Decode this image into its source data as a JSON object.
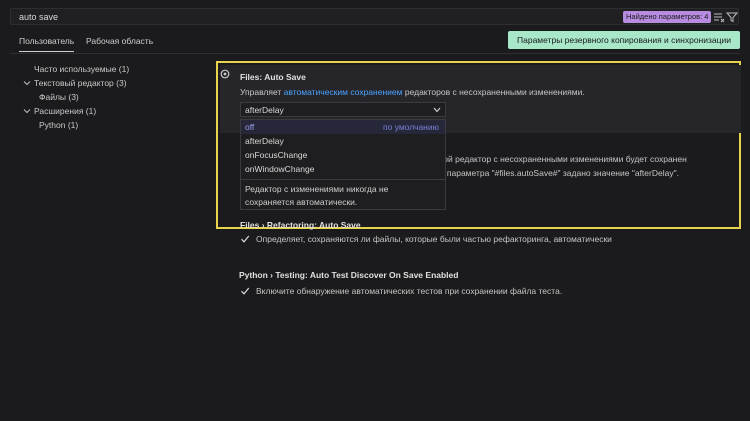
{
  "search": {
    "value": "auto save",
    "found_badge": "Найдено параметров: 4"
  },
  "toolbar": {
    "icons": [
      "clear-filter-icon",
      "filter-icon"
    ]
  },
  "tabs": [
    {
      "label": "Пользователь"
    },
    {
      "label": "Рабочая область"
    }
  ],
  "sync_button": {
    "label": "Параметры резервного копирования и синхронизации"
  },
  "toc": [
    {
      "label": "Часто используемые (1)"
    },
    {
      "label": "Текстовый редактор (3)"
    },
    {
      "label": "Файлы (3)"
    },
    {
      "label": "Расширения (1)"
    },
    {
      "label": "Python (1)"
    }
  ],
  "settings": {
    "auto_save": {
      "title": "Files: Auto Save",
      "desc_before": "Управляет ",
      "desc_link": "автоматическим сохранением",
      "desc_after": " редакторов с несохраненными изменениями.",
      "value": "afterDelay",
      "options": [
        "off",
        "afterDelay",
        "onFocusChange",
        "onWindowChange"
      ],
      "default_label": "по умолчанию",
      "option_description": "Редактор с изменениями никогда не сохраняется автоматически.",
      "partial_desc_1": "торой редактор с несохраненными изменениями будет сохранен",
      "partial_desc_2": "для параметра \"#files.autoSave#\" задано значение \"afterDelay\"."
    },
    "refactoring": {
      "title": "Files › Refactoring: Auto Save",
      "checkbox_label": "Определяет, сохраняются ли файлы, которые были частью рефакторинга, автоматически",
      "checked": true
    },
    "python": {
      "title": "Python › Testing: Auto Test Discover On Save Enabled",
      "checkbox_label": "Включите обнаружение автоматических тестов при сохранении файла теста.",
      "checked": true
    }
  },
  "colors": {
    "background": "#1b1b1d",
    "accent_badge": "#b68be0",
    "sync_button": "#a8e8c9",
    "highlight_border": "#e6d44c",
    "link": "#4aa3ff"
  }
}
